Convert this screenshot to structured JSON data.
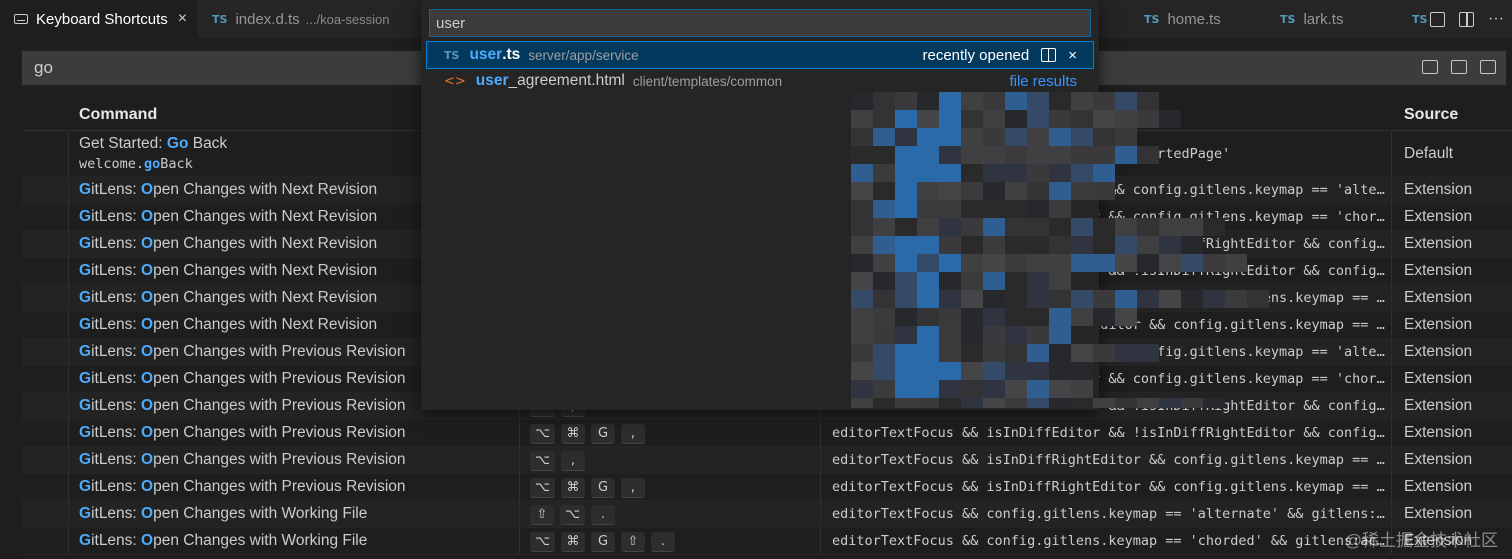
{
  "tabs": [
    {
      "label": "Keyboard Shortcuts",
      "active": true,
      "close": "×"
    },
    {
      "badge": "TS",
      "label": "index.d.ts",
      "path": ".../koa-session"
    },
    {
      "badge": "TS",
      "label": "home.ts"
    },
    {
      "badge": "TS",
      "label": "lark.ts"
    },
    {
      "badge": "TS"
    }
  ],
  "tab_actions": {
    "more": "···"
  },
  "search": {
    "value": "go"
  },
  "table": {
    "header": {
      "command": "Command",
      "source": "Source"
    },
    "rows": [
      {
        "prefix": "Get Started: ",
        "hl": "Go",
        "rest": " Back",
        "cmd_id_hl": "go",
        "cmd_id_pre": "welcome.",
        "cmd_id_post": "Back",
        "keys": [],
        "when": "inWelcome && activeEditor == 'gettingStartedPage'",
        "source": "Default"
      },
      {
        "hl1": "G",
        "mid": "itLens: ",
        "hl2": "O",
        "rest": "pen Changes with Next Revision",
        "keys": [],
        "when": "editorTextFocus && isInDiffEditor && config.gitlens.keymap == 'alternate'",
        "source": "Extension"
      },
      {
        "hl1": "G",
        "mid": "itLens: ",
        "hl2": "O",
        "rest": "pen Changes with Next Revision",
        "keys": [],
        "when": "editorTextFocus && isInDiffEditor && config.gitlens.keymap == 'chorded'",
        "source": "Extension"
      },
      {
        "hl1": "G",
        "mid": "itLens: ",
        "hl2": "O",
        "rest": "pen Changes with Next Revision",
        "keys": [],
        "when": "editorTextFocus && isInDiffEditor && !isInDiffRightEditor && config.gitlens",
        "source": "Extension"
      },
      {
        "hl1": "G",
        "mid": "itLens: ",
        "hl2": "O",
        "rest": "pen Changes with Next Revision",
        "keys": [],
        "when": "editorTextFocus && isInDiffEditor && !isInDiffRightEditor && config.gitlens",
        "source": "Extension"
      },
      {
        "hl1": "G",
        "mid": "itLens: ",
        "hl2": "O",
        "rest": "pen Changes with Next Revision",
        "keys": [],
        "when": "editorTextFocus && isInDiffRightEditor && config.gitlens.keymap == 'alternate'",
        "source": "Extension"
      },
      {
        "hl1": "G",
        "mid": "itLens: ",
        "hl2": "O",
        "rest": "pen Changes with Next Revision",
        "keys": [],
        "when": "editorTextFocus && isInDiffRightEditor && config.gitlens.keymap == 'chorded'",
        "source": "Extension"
      },
      {
        "hl1": "G",
        "mid": "itLens: ",
        "hl2": "O",
        "rest": "pen Changes with Previous Revision",
        "keys": [],
        "when": "editorTextFocus && isInDiffEditor && config.gitlens.keymap == 'alternate'",
        "source": "Extension"
      },
      {
        "hl1": "G",
        "mid": "itLens: ",
        "hl2": "O",
        "rest": "pen Changes with Previous Revision",
        "keys": [],
        "when": "editorTextFocus && isInDiffEditor && config.gitlens.keymap == 'chorded'",
        "source": "Extension"
      },
      {
        "hl1": "G",
        "mid": "itLens: ",
        "hl2": "O",
        "rest": "pen Changes with Previous Revision",
        "keys": [
          "⌥",
          ","
        ],
        "when": "editorTextFocus && isInDiffEditor && !isInDiffRightEditor && config.gitlens",
        "source": "Extension"
      },
      {
        "hl1": "G",
        "mid": "itLens: ",
        "hl2": "O",
        "rest": "pen Changes with Previous Revision",
        "keys": [
          "⌥",
          "⌘",
          "G",
          ","
        ],
        "when": "editorTextFocus && isInDiffEditor && !isInDiffRightEditor && config.gitlens",
        "source": "Extension"
      },
      {
        "hl1": "G",
        "mid": "itLens: ",
        "hl2": "O",
        "rest": "pen Changes with Previous Revision",
        "keys": [
          "⌥",
          ","
        ],
        "when": "editorTextFocus && isInDiffRightEditor && config.gitlens.keymap == 'alternate'",
        "source": "Extension"
      },
      {
        "hl1": "G",
        "mid": "itLens: ",
        "hl2": "O",
        "rest": "pen Changes with Previous Revision",
        "keys": [
          "⌥",
          "⌘",
          "G",
          ","
        ],
        "when": "editorTextFocus && isInDiffRightEditor && config.gitlens.keymap == 'chorded'",
        "source": "Extension"
      },
      {
        "hl1": "G",
        "mid": "itLens: ",
        "hl2": "O",
        "rest": "pen Changes with Working File",
        "keys": [
          "⇧",
          "⌥",
          "."
        ],
        "when": "editorTextFocus && config.gitlens.keymap == 'alternate' && gitlens:activeFileStatus",
        "source": "Extension"
      },
      {
        "hl1": "G",
        "mid": "itLens: ",
        "hl2": "O",
        "rest": "pen Changes with Working File",
        "keys": [
          "⌥",
          "⌘",
          "G",
          "⇧",
          "."
        ],
        "when": "editorTextFocus && config.gitlens.keymap == 'chorded' && gitlens:activeFileStatus",
        "source": "Extension"
      }
    ]
  },
  "quick_open": {
    "input": "user",
    "items": [
      {
        "badge": "TS",
        "hl": "user",
        "rest": ".ts",
        "desc": "server/app/service",
        "right": "recently opened",
        "close": "×"
      },
      {
        "badge": "<>",
        "hl": "user",
        "rest": "_agreement.html",
        "desc": "client/templates/common",
        "right": "file results"
      }
    ]
  },
  "watermark": "@稀土掘金技术社区"
}
